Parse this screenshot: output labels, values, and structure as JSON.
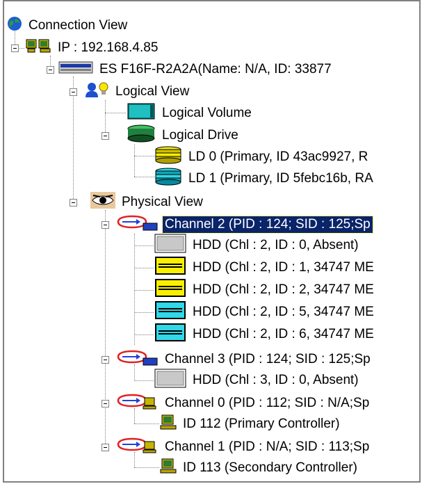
{
  "tree": {
    "root": "Connection View",
    "ip": "IP : 192.168.4.85",
    "enclosure": "ES F16F-R2A2A(Name: N/A, ID: 33877",
    "logical_view": "Logical View",
    "logical_volume": "Logical Volume",
    "logical_drive": "Logical Drive",
    "ld0": "LD 0 (Primary, ID 43ac9927, R",
    "ld1": "LD 1 (Primary, ID 5febc16b, RA",
    "physical_view": "Physical View",
    "channel2": "Channel 2 (PID : 124; SID : 125;Sp",
    "hdd_c2_0": "HDD  (Chl : 2, ID : 0, Absent)",
    "hdd_c2_1": "HDD  (Chl : 2, ID : 1, 34747 ME",
    "hdd_c2_2": "HDD  (Chl : 2, ID : 2, 34747 ME",
    "hdd_c2_5": "HDD  (Chl : 2, ID : 5, 34747 ME",
    "hdd_c2_6": "HDD  (Chl : 2, ID : 6, 34747 ME",
    "channel3": "Channel 3 (PID : 124; SID : 125;Sp",
    "hdd_c3_0": "HDD  (Chl : 3, ID : 0, Absent)",
    "channel0": "Channel 0 (PID : 112; SID : N/A;Sp",
    "id112": "ID 112 (Primary Controller)",
    "channel1": "Channel 1 (PID : N/A; SID : 113;Sp",
    "id113": "ID 113 (Secondary Controller)"
  },
  "icons": {
    "root": "globe-icon",
    "ip": "network-computers-icon",
    "enclosure": "storage-enclosure-icon",
    "logical_view": "user-lightbulb-icon",
    "logical_volume": "logical-volume-icon",
    "logical_drive": "logical-drive-icon",
    "physical_view": "eye-icon",
    "channel": "channel-icon",
    "hdd": "hard-disk-icon",
    "controller": "controller-computer-icon"
  },
  "colors": {
    "selection_bg": "#0a246a",
    "drive_yellow": "#f8f000",
    "drive_cyan": "#30d8e8",
    "drive_absent": "#c8c8c8",
    "volume_teal": "#008080"
  }
}
